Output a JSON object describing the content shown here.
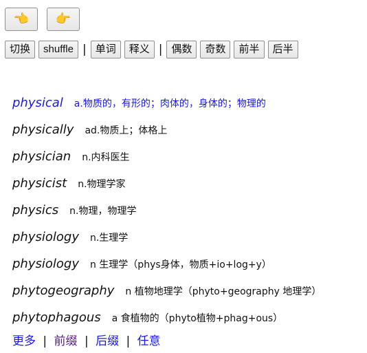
{
  "nav": {
    "prev_icon": "👈",
    "next_icon": "👉"
  },
  "toolbar": {
    "switch": "切换",
    "shuffle": "shuffle",
    "word": "单词",
    "meaning": "释义",
    "even": "偶数",
    "odd": "奇数",
    "first_half": "前半",
    "second_half": "后半",
    "separator": "|"
  },
  "words": [
    {
      "word": "physical",
      "meaning": "a.物质的，有形的；肉体的，身体的；物理的"
    },
    {
      "word": "physically",
      "meaning": "ad.物质上；体格上"
    },
    {
      "word": "physician",
      "meaning": "n.内科医生"
    },
    {
      "word": "physicist",
      "meaning": "n.物理学家"
    },
    {
      "word": "physics",
      "meaning": "n.物理，物理学"
    },
    {
      "word": "physiology",
      "meaning": "n.生理学"
    },
    {
      "word": "physiology",
      "meaning": "n 生理学（phys身体，物质+io+log+y）"
    },
    {
      "word": "phytogeography",
      "meaning": "n 植物地理学（phyto+geography 地理学）"
    },
    {
      "word": "phytophagous",
      "meaning": "a 食植物的（phyto植物+phag+ous）"
    }
  ],
  "footer": {
    "more": "更多",
    "prefix": "前缀",
    "suffix": "后缀",
    "random": "任意",
    "separator": "|"
  },
  "colors": {
    "link": "#1a1ae6",
    "visited": "#551a8b"
  }
}
